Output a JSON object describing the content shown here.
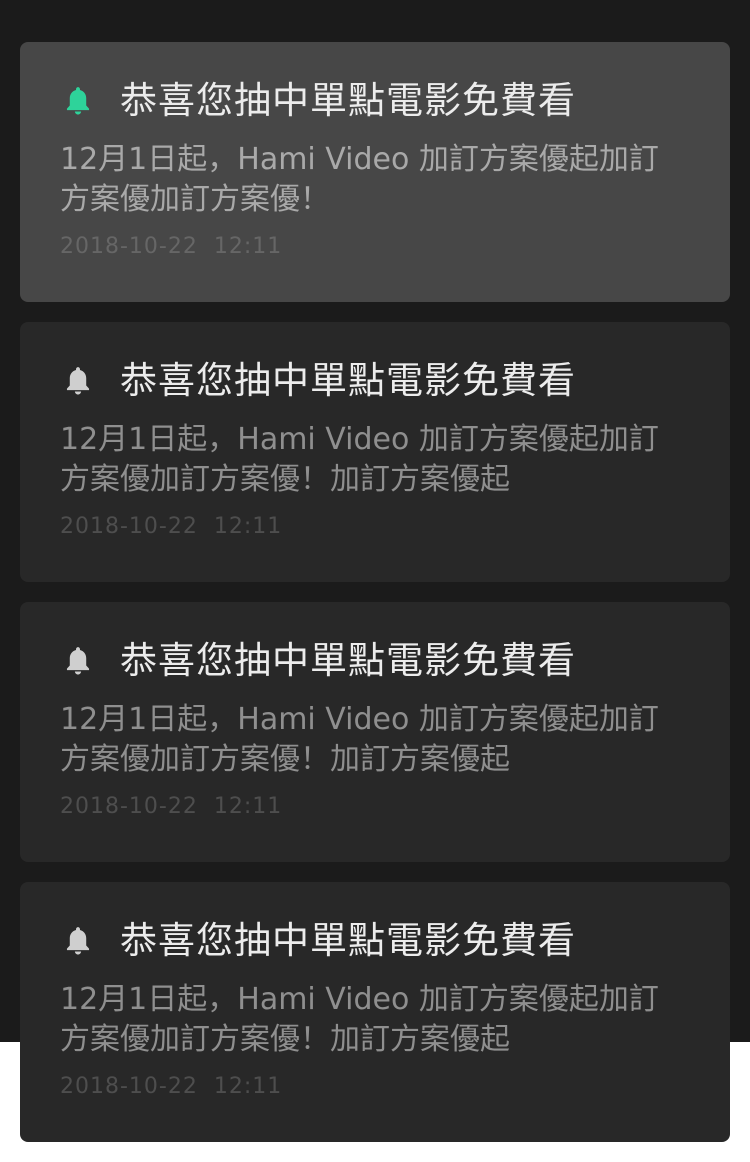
{
  "colors": {
    "screen_background": "#1b1b1b",
    "card_unread_background": "#474747",
    "card_read_background": "#282828",
    "bell_unread": "#2ed39a",
    "bell_read": "#cfcfcf",
    "title_text": "#ececec",
    "body_text": "#8f8f8f",
    "time_text": "#4e4e4e"
  },
  "notifications": [
    {
      "icon": "bell-icon",
      "unread": true,
      "title": "恭喜您抽中單點電影免費看",
      "body": "12月1日起，Hami Video 加訂方案優起加訂方案優加訂方案優！",
      "time": "2018-10-22  12:11"
    },
    {
      "icon": "bell-icon",
      "unread": false,
      "title": "恭喜您抽中單點電影免費看",
      "body": "12月1日起，Hami Video 加訂方案優起加訂方案優加訂方案優！加訂方案優起",
      "time": "2018-10-22  12:11"
    },
    {
      "icon": "bell-icon",
      "unread": false,
      "title": "恭喜您抽中單點電影免費看",
      "body": "12月1日起，Hami Video 加訂方案優起加訂方案優加訂方案優！加訂方案優起",
      "time": "2018-10-22  12:11"
    },
    {
      "icon": "bell-icon",
      "unread": false,
      "title": "恭喜您抽中單點電影免費看",
      "body": "12月1日起，Hami Video 加訂方案優起加訂方案優加訂方案優！加訂方案優起",
      "time": "2018-10-22  12:11"
    }
  ]
}
